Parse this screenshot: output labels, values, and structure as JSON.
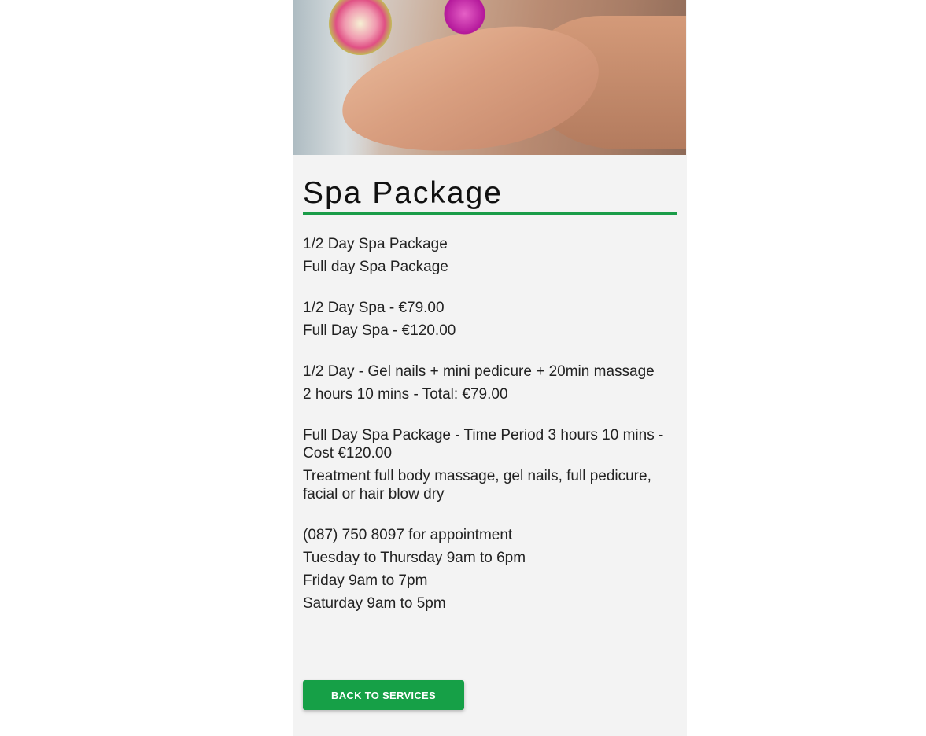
{
  "hero": {
    "image_alt": "Pedicure foot bath with flowers"
  },
  "page_title": "Spa Package",
  "lines": [
    "1/2 Day Spa Package",
    "Full day Spa Package",
    "",
    "1/2 Day Spa - €79.00",
    "Full Day Spa - €120.00",
    "",
    "1/2 Day - Gel nails + mini pedicure + 20min massage",
    "2 hours 10 mins - Total: €79.00",
    "",
    "Full Day Spa Package - Time Period 3 hours 10 mins - Cost €120.00",
    "Treatment full body massage, gel nails, full pedicure, facial or hair blow dry",
    "",
    "(087) 750 8097 for appointment",
    "Tuesday to Thursday 9am to 6pm",
    "Friday 9am to 7pm",
    "Saturday 9am to 5pm"
  ],
  "back_button": {
    "label": "BACK TO SERVICES"
  },
  "colors": {
    "accent": "#16a047",
    "card_bg": "#f3f3f3"
  }
}
